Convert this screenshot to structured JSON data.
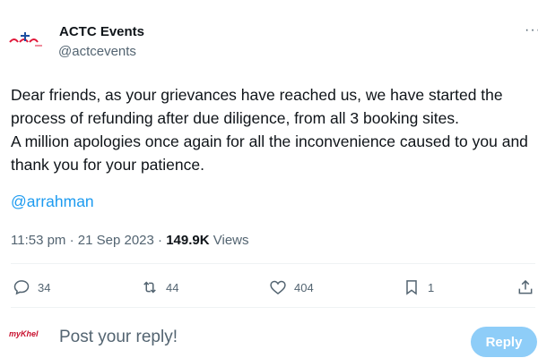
{
  "author": {
    "name": "ACTC Events",
    "handle": "@actcevents",
    "logo_text": "actc",
    "brand_color": "#e0193a"
  },
  "more_icon": "more-horizontal-icon",
  "tweet": {
    "paragraphs": [
      "Dear friends, as your grievances have reached us, we have started the process of refunding after due diligence, from all 3 booking sites.",
      "A million apologies once again for all the inconvenience caused to you and thank you for your patience."
    ],
    "mention": "@arrahman",
    "time": "11:53 pm",
    "separator": "·",
    "date": "21 Sep 2023",
    "views_count": "149.9K",
    "views_label": "Views"
  },
  "actions": {
    "replies": "34",
    "reposts": "44",
    "likes": "404",
    "bookmarks": "1"
  },
  "reply_bar": {
    "avatar_text": "myKhel",
    "placeholder": "Post your reply!",
    "button_label": "Reply"
  },
  "colors": {
    "accent": "#1d9bf0",
    "reply_button_disabled": "#8ecdf8",
    "muted": "#536471"
  }
}
